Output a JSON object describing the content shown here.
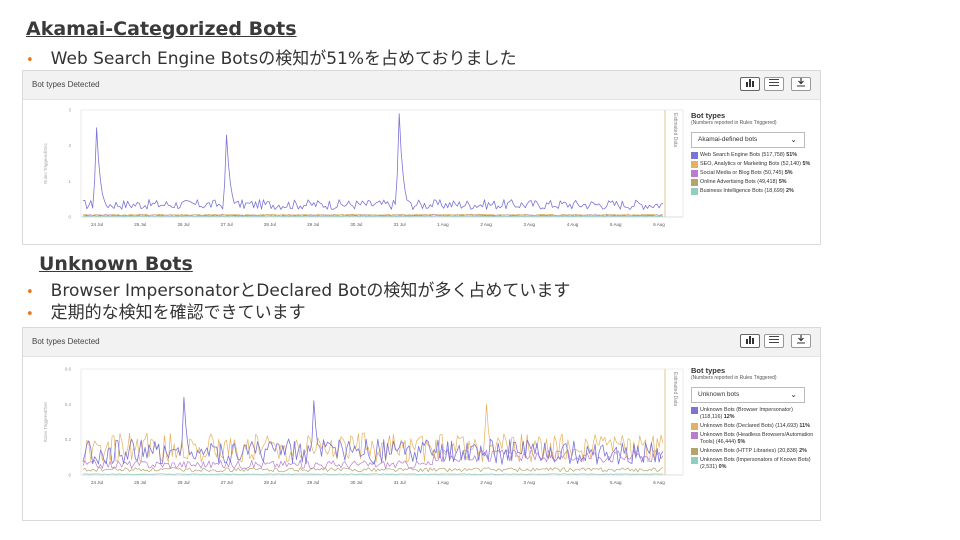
{
  "section1": {
    "heading": "Akamai-Categorized Bots",
    "bullets": [
      "Web Search Engine Botsの検知が51%を占めておりました"
    ]
  },
  "section2": {
    "heading": "Unknown Bots",
    "bullets": [
      "Browser ImpersonatorとDeclared Botの検知が多く占めています",
      "定期的な検知を確認できています"
    ]
  },
  "panel1": {
    "title": "Bot types Detected",
    "toolbar": {
      "chart_icon": "bar-chart-icon",
      "list_icon": "list-icon",
      "download_icon": "download-icon"
    },
    "ylabel": "Rules Triggered/Sec",
    "estimated_label": "Estimated Data",
    "legend": {
      "title": "Bot types",
      "subtitle": "(Numbers reported in Rules Triggered)",
      "dropdown_value": "Akamai-defined bots",
      "items": [
        {
          "label": "Web Search Engine Bots (517,758)",
          "pct": "51%",
          "color": "#7b74d6"
        },
        {
          "label": "SEO, Analytics or Marketing Bots (52,140)",
          "pct": "5%",
          "color": "#e6b15e"
        },
        {
          "label": "Social Media or Blog Bots (50,745)",
          "pct": "5%",
          "color": "#b77dcf"
        },
        {
          "label": "Online Advertising Bots (49,418)",
          "pct": "5%",
          "color": "#b3a46b"
        },
        {
          "label": "Business Intelligence Bots (18,699)",
          "pct": "2%",
          "color": "#8fcfc0"
        }
      ]
    }
  },
  "panel2": {
    "title": "Bot types Detected",
    "toolbar": {
      "chart_icon": "bar-chart-icon",
      "list_icon": "list-icon",
      "download_icon": "download-icon"
    },
    "ylabel": "Rules Triggered/Sec",
    "estimated_label": "Estimated Data",
    "legend": {
      "title": "Bot types",
      "subtitle": "(Numbers reported in Rules Triggered)",
      "dropdown_value": "Unknown bots",
      "items": [
        {
          "label": "Unknown Bots (Browser Impersonator) (118,116)",
          "pct": "12%",
          "color": "#7b74d6"
        },
        {
          "label": "Unknown Bots (Declared Bots) (114,693)",
          "pct": "11%",
          "color": "#e6b15e"
        },
        {
          "label": "Unknown Bots (Headless Browsers/Automation Tools) (46,444)",
          "pct": "5%",
          "color": "#b77dcf"
        },
        {
          "label": "Unknown Bots (HTTP Libraries) (20,838)",
          "pct": "2%",
          "color": "#b3a46b"
        },
        {
          "label": "Unknown Bots (Impersonators of Known Bots) (2,531)",
          "pct": "0%",
          "color": "#8fcfc0"
        }
      ]
    }
  },
  "chart_data": [
    {
      "type": "line",
      "x": [
        "24 Jul",
        "25 Jul",
        "26 Jul",
        "27 Jul",
        "28 Jul",
        "29 Jul",
        "30 Jul",
        "31 Jul",
        "1 Aug",
        "2 Aug",
        "3 Aug",
        "4 Aug",
        "5 Aug",
        "6 Aug"
      ],
      "yticks": [
        "3",
        "2",
        "1",
        "0"
      ],
      "ylim": [
        0,
        3
      ],
      "ylabel": "Rules Triggered/Sec",
      "grid": false,
      "legend_position": "right",
      "spikes": [
        {
          "x": "24 Jul",
          "y": 2.5
        },
        {
          "x": "27 Jul",
          "y": 2.3
        },
        {
          "x": "31 Jul",
          "y": 2.9
        }
      ],
      "series": [
        {
          "name": "Web Search Engine Bots",
          "baseline": 0.35,
          "color": "#7b74d6"
        },
        {
          "name": "SEO, Analytics or Marketing Bots",
          "baseline": 0.06,
          "color": "#e6b15e"
        },
        {
          "name": "Social Media or Blog Bots",
          "baseline": 0.05,
          "color": "#b77dcf"
        },
        {
          "name": "Online Advertising Bots",
          "baseline": 0.05,
          "color": "#b3a46b"
        },
        {
          "name": "Business Intelligence Bots",
          "baseline": 0.02,
          "color": "#8fcfc0"
        }
      ]
    },
    {
      "type": "line",
      "x": [
        "24 Jul",
        "25 Jul",
        "26 Jul",
        "27 Jul",
        "28 Jul",
        "29 Jul",
        "30 Jul",
        "31 Jul",
        "1 Aug",
        "2 Aug",
        "3 Aug",
        "4 Aug",
        "5 Aug",
        "6 Aug"
      ],
      "yticks": [
        "0.6",
        "0.4",
        "0.2",
        "0"
      ],
      "ylim": [
        0,
        0.6
      ],
      "ylabel": "Rules Triggered/Sec",
      "grid": false,
      "legend_position": "right",
      "spikes": [
        {
          "x": "26 Jul",
          "y": 0.44
        },
        {
          "x": "29 Jul",
          "y": 0.42
        },
        {
          "x": "2 Aug",
          "y": 0.4
        }
      ],
      "series": [
        {
          "name": "Unknown Bots (Browser Impersonator)",
          "baseline": 0.12,
          "color": "#7b74d6"
        },
        {
          "name": "Unknown Bots (Declared Bots)",
          "baseline": 0.14,
          "color": "#e6b15e"
        },
        {
          "name": "Unknown Bots (Headless Browsers/Automation Tools)",
          "baseline": 0.06,
          "color": "#b77dcf"
        },
        {
          "name": "Unknown Bots (HTTP Libraries)",
          "baseline": 0.03,
          "color": "#b3a46b"
        },
        {
          "name": "Unknown Bots (Impersonators of Known Bots)",
          "baseline": 0.005,
          "color": "#8fcfc0"
        }
      ]
    }
  ]
}
